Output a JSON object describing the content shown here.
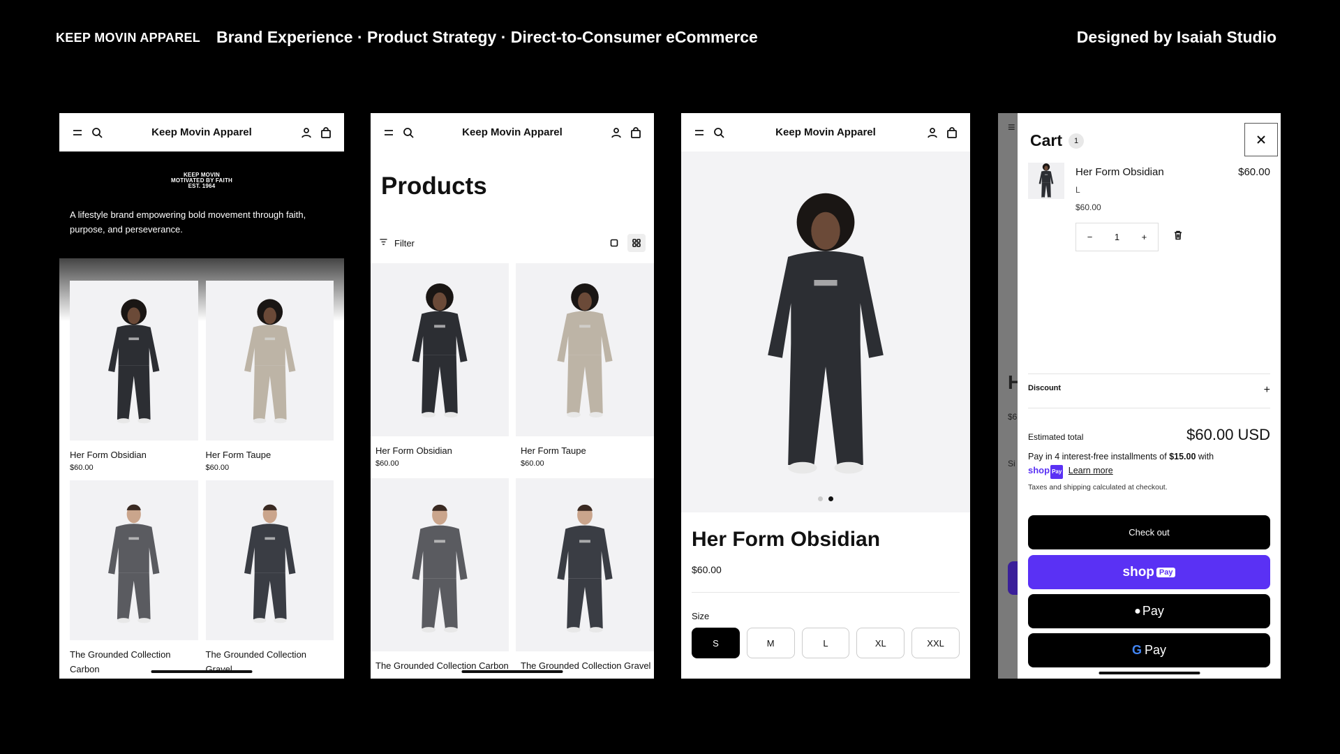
{
  "header": {
    "brand": "KEEP MOVIN APPAREL",
    "tagline": "Brand Experience · Product Strategy · Direct-to-Consumer eCommerce",
    "credit": "Designed by Isaiah Studio"
  },
  "store": {
    "name": "Keep Movin Apparel"
  },
  "home": {
    "logo_lines": [
      "KEEP MOVIN",
      "MOTIVATED BY FAITH",
      "EST. 1964"
    ],
    "intro": "A lifestyle brand empowering bold movement through faith, purpose, and perseverance."
  },
  "products": [
    {
      "name": "Her Form Obsidian",
      "price": "$60.00",
      "color": "#2c2e33",
      "model": "her"
    },
    {
      "name": "Her Form Taupe",
      "price": "$60.00",
      "color": "#bdb4a6",
      "model": "her"
    },
    {
      "name": "The Grounded Collection Carbon",
      "price": "",
      "color": "#5a5b60",
      "model": "him"
    },
    {
      "name": "The Grounded Collection Gravel",
      "price": "",
      "color": "#3a3d44",
      "model": "him"
    }
  ],
  "listing": {
    "title": "Products",
    "filter_label": "Filter"
  },
  "pdp": {
    "title": "Her Form Obsidian",
    "price": "$60.00",
    "size_label": "Size",
    "sizes": [
      "S",
      "M",
      "L",
      "XL",
      "XXL"
    ],
    "selected_size": "S",
    "image_count": 2,
    "image_index": 1
  },
  "cart": {
    "title": "Cart",
    "count": "1",
    "item": {
      "name": "Her Form Obsidian",
      "variant": "L",
      "unit_price": "$60.00",
      "line_price": "$60.00",
      "quantity": "1"
    },
    "discount_label": "Discount",
    "estimated_total_label": "Estimated total",
    "estimated_total": "$60.00 USD",
    "installments_prefix": "Pay in 4 interest-free installments of",
    "installment_amount": "$15.00",
    "installments_suffix": "with",
    "shop_word": "shop",
    "pay_badge": "Pay",
    "learn_more": "Learn more",
    "taxes_note": "Taxes and shipping calculated at checkout.",
    "checkout_label": "Check out",
    "shop_pay_label": "shop",
    "apple_pay_label": "Pay",
    "google_pay_g": "G",
    "google_pay_label": "Pay",
    "behind_letter": "H",
    "behind_price": "$6",
    "behind_size": "Si"
  },
  "colors": {
    "background": "#000000",
    "shop_pay": "#5a31f4",
    "image_bg": "#f2f2f4"
  }
}
